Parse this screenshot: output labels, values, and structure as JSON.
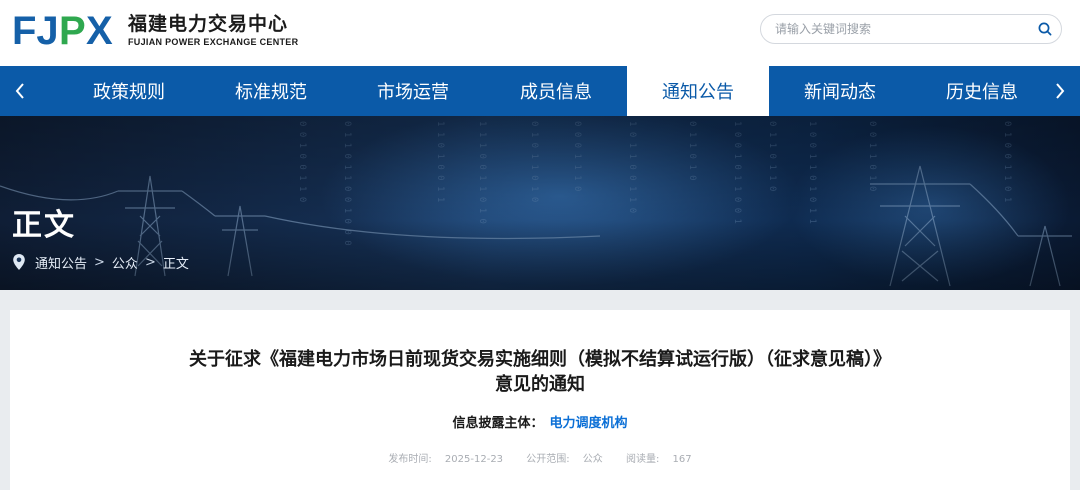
{
  "header": {
    "logo_mark": "FJPX",
    "logo_cn": "福建电力交易中心",
    "logo_en": "FUJIAN POWER EXCHANGE CENTER",
    "search_placeholder": "请输入关键词搜索"
  },
  "nav": {
    "items": [
      {
        "label": "政策规则"
      },
      {
        "label": "标准规范"
      },
      {
        "label": "市场运营"
      },
      {
        "label": "成员信息"
      },
      {
        "label": "通知公告",
        "active": true
      },
      {
        "label": "新闻动态"
      },
      {
        "label": "历史信息"
      }
    ]
  },
  "banner": {
    "title": "正文",
    "breadcrumb": [
      "通知公告",
      "公众",
      "正文"
    ]
  },
  "article": {
    "title_line1": "关于征求《福建电力市场日前现货交易实施细则（模拟不结算试运行版）（征求意见稿）》",
    "title_line2": "意见的通知",
    "subject_label": "信息披露主体：",
    "subject_value": "电力调度机构",
    "meta": {
      "date_label": "发布时间:",
      "date": "2025-12-23",
      "scope_label": "公开范围:",
      "scope": "公众",
      "views_label": "阅读量:",
      "views": "167"
    }
  },
  "colors": {
    "brand_blue": "#0b5aa8",
    "logo_blue": "#1560a8",
    "logo_green": "#2fa84f",
    "link_blue": "#0b6fd6"
  }
}
